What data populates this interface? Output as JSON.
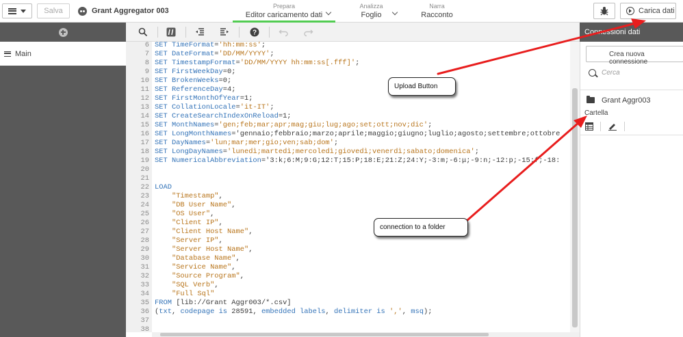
{
  "topbar": {
    "save_label": "Salva",
    "app_title": "Grant Aggregator 003",
    "nav": [
      {
        "small": "Prepara",
        "big": "Editor caricamento dati"
      },
      {
        "small": "Analizza",
        "big": "Foglio"
      },
      {
        "small": "Narra",
        "big": "Racconto"
      }
    ],
    "load_label": "Carica dati",
    "accent_color": "#52cc52"
  },
  "sidebar": {
    "section_label": "Main"
  },
  "editor": {
    "lines": [
      {
        "n": "6",
        "text": "SET TimeFormat='hh:mm:ss';"
      },
      {
        "n": "7",
        "text": "SET DateFormat='DD/MM/YYYY';"
      },
      {
        "n": "8",
        "text": "SET TimestampFormat='DD/MM/YYYY hh:mm:ss[.fff]';"
      },
      {
        "n": "9",
        "text": "SET FirstWeekDay=0;"
      },
      {
        "n": "10",
        "text": "SET BrokenWeeks=0;"
      },
      {
        "n": "11",
        "text": "SET ReferenceDay=4;"
      },
      {
        "n": "12",
        "text": "SET FirstMonthOfYear=1;"
      },
      {
        "n": "13",
        "text": "SET CollationLocale='it-IT';"
      },
      {
        "n": "14",
        "text": "SET CreateSearchIndexOnReload=1;"
      },
      {
        "n": "15",
        "text": "SET MonthNames='gen;feb;mar;apr;mag;giu;lug;ago;set;ott;nov;dic';"
      },
      {
        "n": "16",
        "text": "SET LongMonthNames='gennaio;febbraio;marzo;aprile;maggio;giugno;luglio;agosto;settembre;ottobre"
      },
      {
        "n": "17",
        "text": "SET DayNames='lun;mar;mer;gio;ven;sab;dom';"
      },
      {
        "n": "18",
        "text": "SET LongDayNames='lunedì;martedì;mercoledì;giovedì;venerdì;sabato;domenica';"
      },
      {
        "n": "19",
        "text": "SET NumericalAbbreviation='3:k;6:M;9:G;12:T;15:P;18:E;21:Z;24:Y;-3:m;-6:μ;-9:n;-12:p;-15:f;-18:"
      },
      {
        "n": "20",
        "text": ""
      },
      {
        "n": "21",
        "text": ""
      },
      {
        "n": "22",
        "text": "LOAD"
      },
      {
        "n": "23",
        "text": "    \"Timestamp\","
      },
      {
        "n": "24",
        "text": "    \"DB User Name\","
      },
      {
        "n": "25",
        "text": "    \"OS User\","
      },
      {
        "n": "26",
        "text": "    \"Client IP\","
      },
      {
        "n": "27",
        "text": "    \"Client Host Name\","
      },
      {
        "n": "28",
        "text": "    \"Server IP\","
      },
      {
        "n": "29",
        "text": "    \"Server Host Name\","
      },
      {
        "n": "30",
        "text": "    \"Database Name\","
      },
      {
        "n": "31",
        "text": "    \"Service Name\","
      },
      {
        "n": "32",
        "text": "    \"Source Program\","
      },
      {
        "n": "33",
        "text": "    \"SQL Verb\","
      },
      {
        "n": "34",
        "text": "    \"Full Sql\""
      },
      {
        "n": "35",
        "text": "FROM [lib://Grant Aggr003/*.csv]"
      },
      {
        "n": "36",
        "text": "(txt, codepage is 28591, embedded labels, delimiter is ',', msq);"
      },
      {
        "n": "37",
        "text": ""
      },
      {
        "n": "38",
        "text": ""
      }
    ]
  },
  "connections": {
    "title": "Connessioni dati",
    "new_label": "Crea nuova connessione",
    "search_placeholder": "Cerca",
    "item_name": "Grant Aggr003",
    "item_type": "Cartella"
  },
  "annotations": {
    "upload": "Upload Button",
    "folder": "connection to a folder",
    "arrow_color": "#e81d1d"
  }
}
